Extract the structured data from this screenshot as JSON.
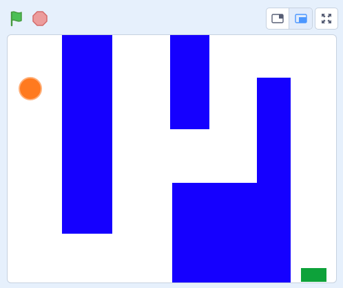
{
  "toolbar": {
    "green_flag": {
      "icon": "green-flag-icon",
      "color": "#4cbf56",
      "stroke": "#45993d"
    },
    "stop": {
      "icon": "stop-sign-icon",
      "color": "#ec9c9c",
      "stroke": "#d36a6a"
    },
    "modes": [
      {
        "icon": "small-stage-icon",
        "selected": false
      },
      {
        "icon": "large-stage-icon",
        "selected": true
      }
    ],
    "fullscreen": {
      "icon": "fullscreen-icon"
    }
  },
  "stage": {
    "background": "#ffffff",
    "walls_color": "#1500ff",
    "player_color": "#ff7a1f",
    "goal_color": "#0da23a"
  }
}
